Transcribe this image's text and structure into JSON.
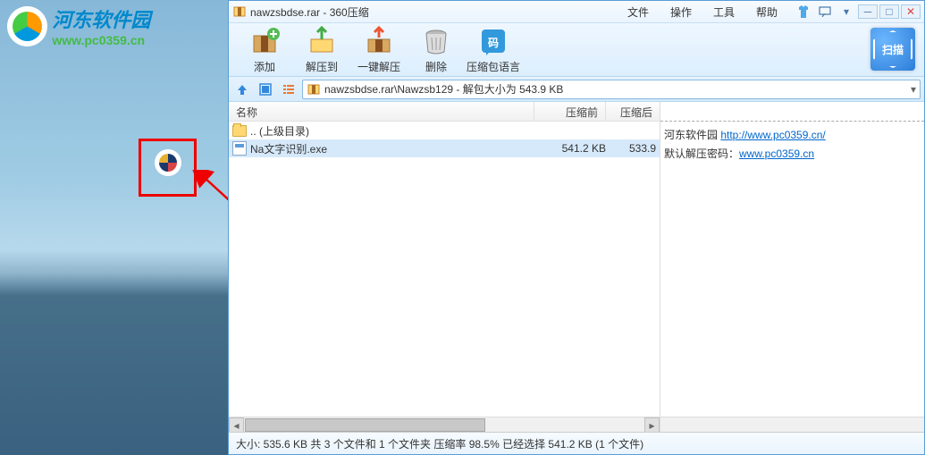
{
  "desktop": {
    "logo_cn": "河东软件园",
    "logo_en": "www.pc0359.cn"
  },
  "window": {
    "title": "nawzsbdse.rar - 360压缩",
    "menu": [
      "文件",
      "操作",
      "工具",
      "帮助"
    ],
    "toolbar": [
      {
        "label": "添加",
        "icon": "add"
      },
      {
        "label": "解压到",
        "icon": "extract-to"
      },
      {
        "label": "一键解压",
        "icon": "quick-extract"
      },
      {
        "label": "删除",
        "icon": "delete"
      },
      {
        "label": "压缩包语言",
        "icon": "language"
      }
    ],
    "scan_label": "扫描",
    "path_text": "nawzsbdse.rar\\Nawzsb129 - 解包大小为 543.9 KB",
    "columns": {
      "name": "名称",
      "pre": "压缩前",
      "post": "压缩后"
    },
    "rows": [
      {
        "name": ".. (上级目录)",
        "type": "folder",
        "pre": "",
        "post": ""
      },
      {
        "name": "Na文字识别.exe",
        "type": "exe",
        "pre": "541.2 KB",
        "post": "533.9",
        "selected": true
      }
    ],
    "side": {
      "line1_prefix": "河东软件园 ",
      "line1_link": "http://www.pc0359.cn/",
      "line2_prefix": "默认解压密码：",
      "line2_link": "www.pc0359.cn"
    },
    "statusbar": "大小: 535.6 KB 共 3 个文件和 1 个文件夹 压缩率 98.5% 已经选择 541.2 KB (1 个文件)"
  }
}
